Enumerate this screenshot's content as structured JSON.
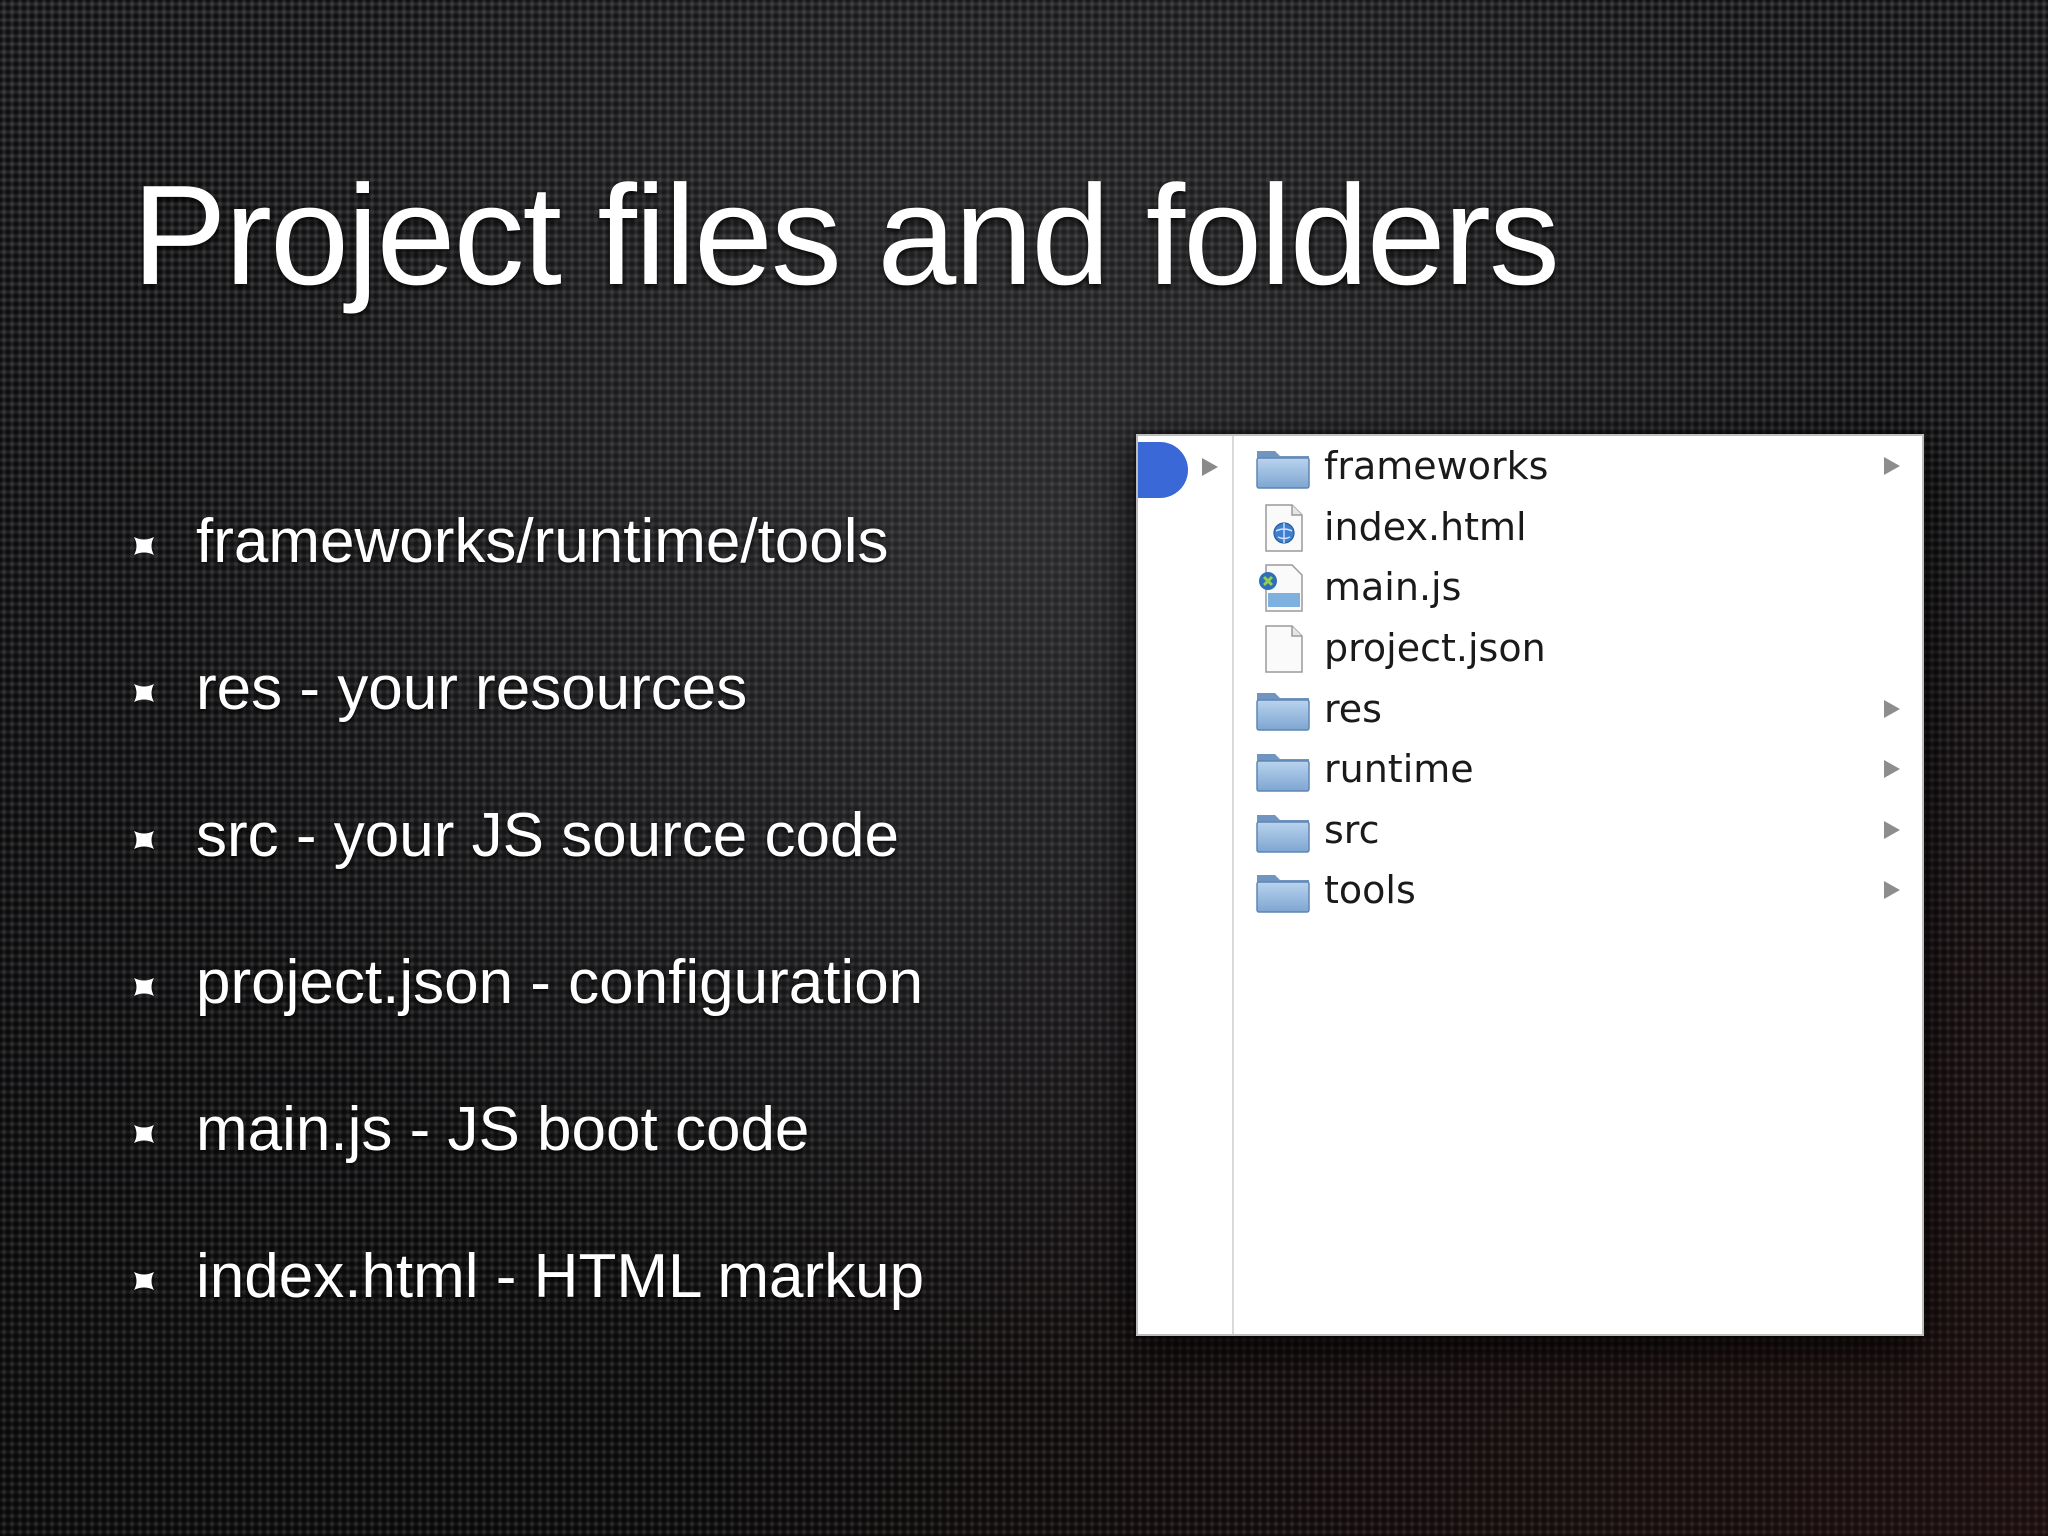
{
  "slide": {
    "title": "Project files and folders",
    "bullets": [
      "frameworks/runtime/tools",
      "res - your resources",
      "src - your JS source code",
      "project.json - configuration",
      "main.js - JS boot code",
      "index.html - HTML markup"
    ]
  },
  "finder": {
    "items": [
      {
        "name": "frameworks",
        "kind": "folder",
        "icon": "folder-icon",
        "has_children": true
      },
      {
        "name": "index.html",
        "kind": "html",
        "icon": "html-file-icon",
        "has_children": false
      },
      {
        "name": "main.js",
        "kind": "script",
        "icon": "js-file-icon",
        "has_children": false
      },
      {
        "name": "project.json",
        "kind": "document",
        "icon": "document-icon",
        "has_children": false
      },
      {
        "name": "res",
        "kind": "folder",
        "icon": "folder-icon",
        "has_children": true
      },
      {
        "name": "runtime",
        "kind": "folder",
        "icon": "folder-icon",
        "has_children": true
      },
      {
        "name": "src",
        "kind": "folder",
        "icon": "folder-icon",
        "has_children": true
      },
      {
        "name": "tools",
        "kind": "folder",
        "icon": "folder-icon",
        "has_children": true
      }
    ]
  },
  "colors": {
    "selection": "#3a68d6",
    "folder": "#8fb3d9",
    "window_bg": "#ffffff"
  }
}
